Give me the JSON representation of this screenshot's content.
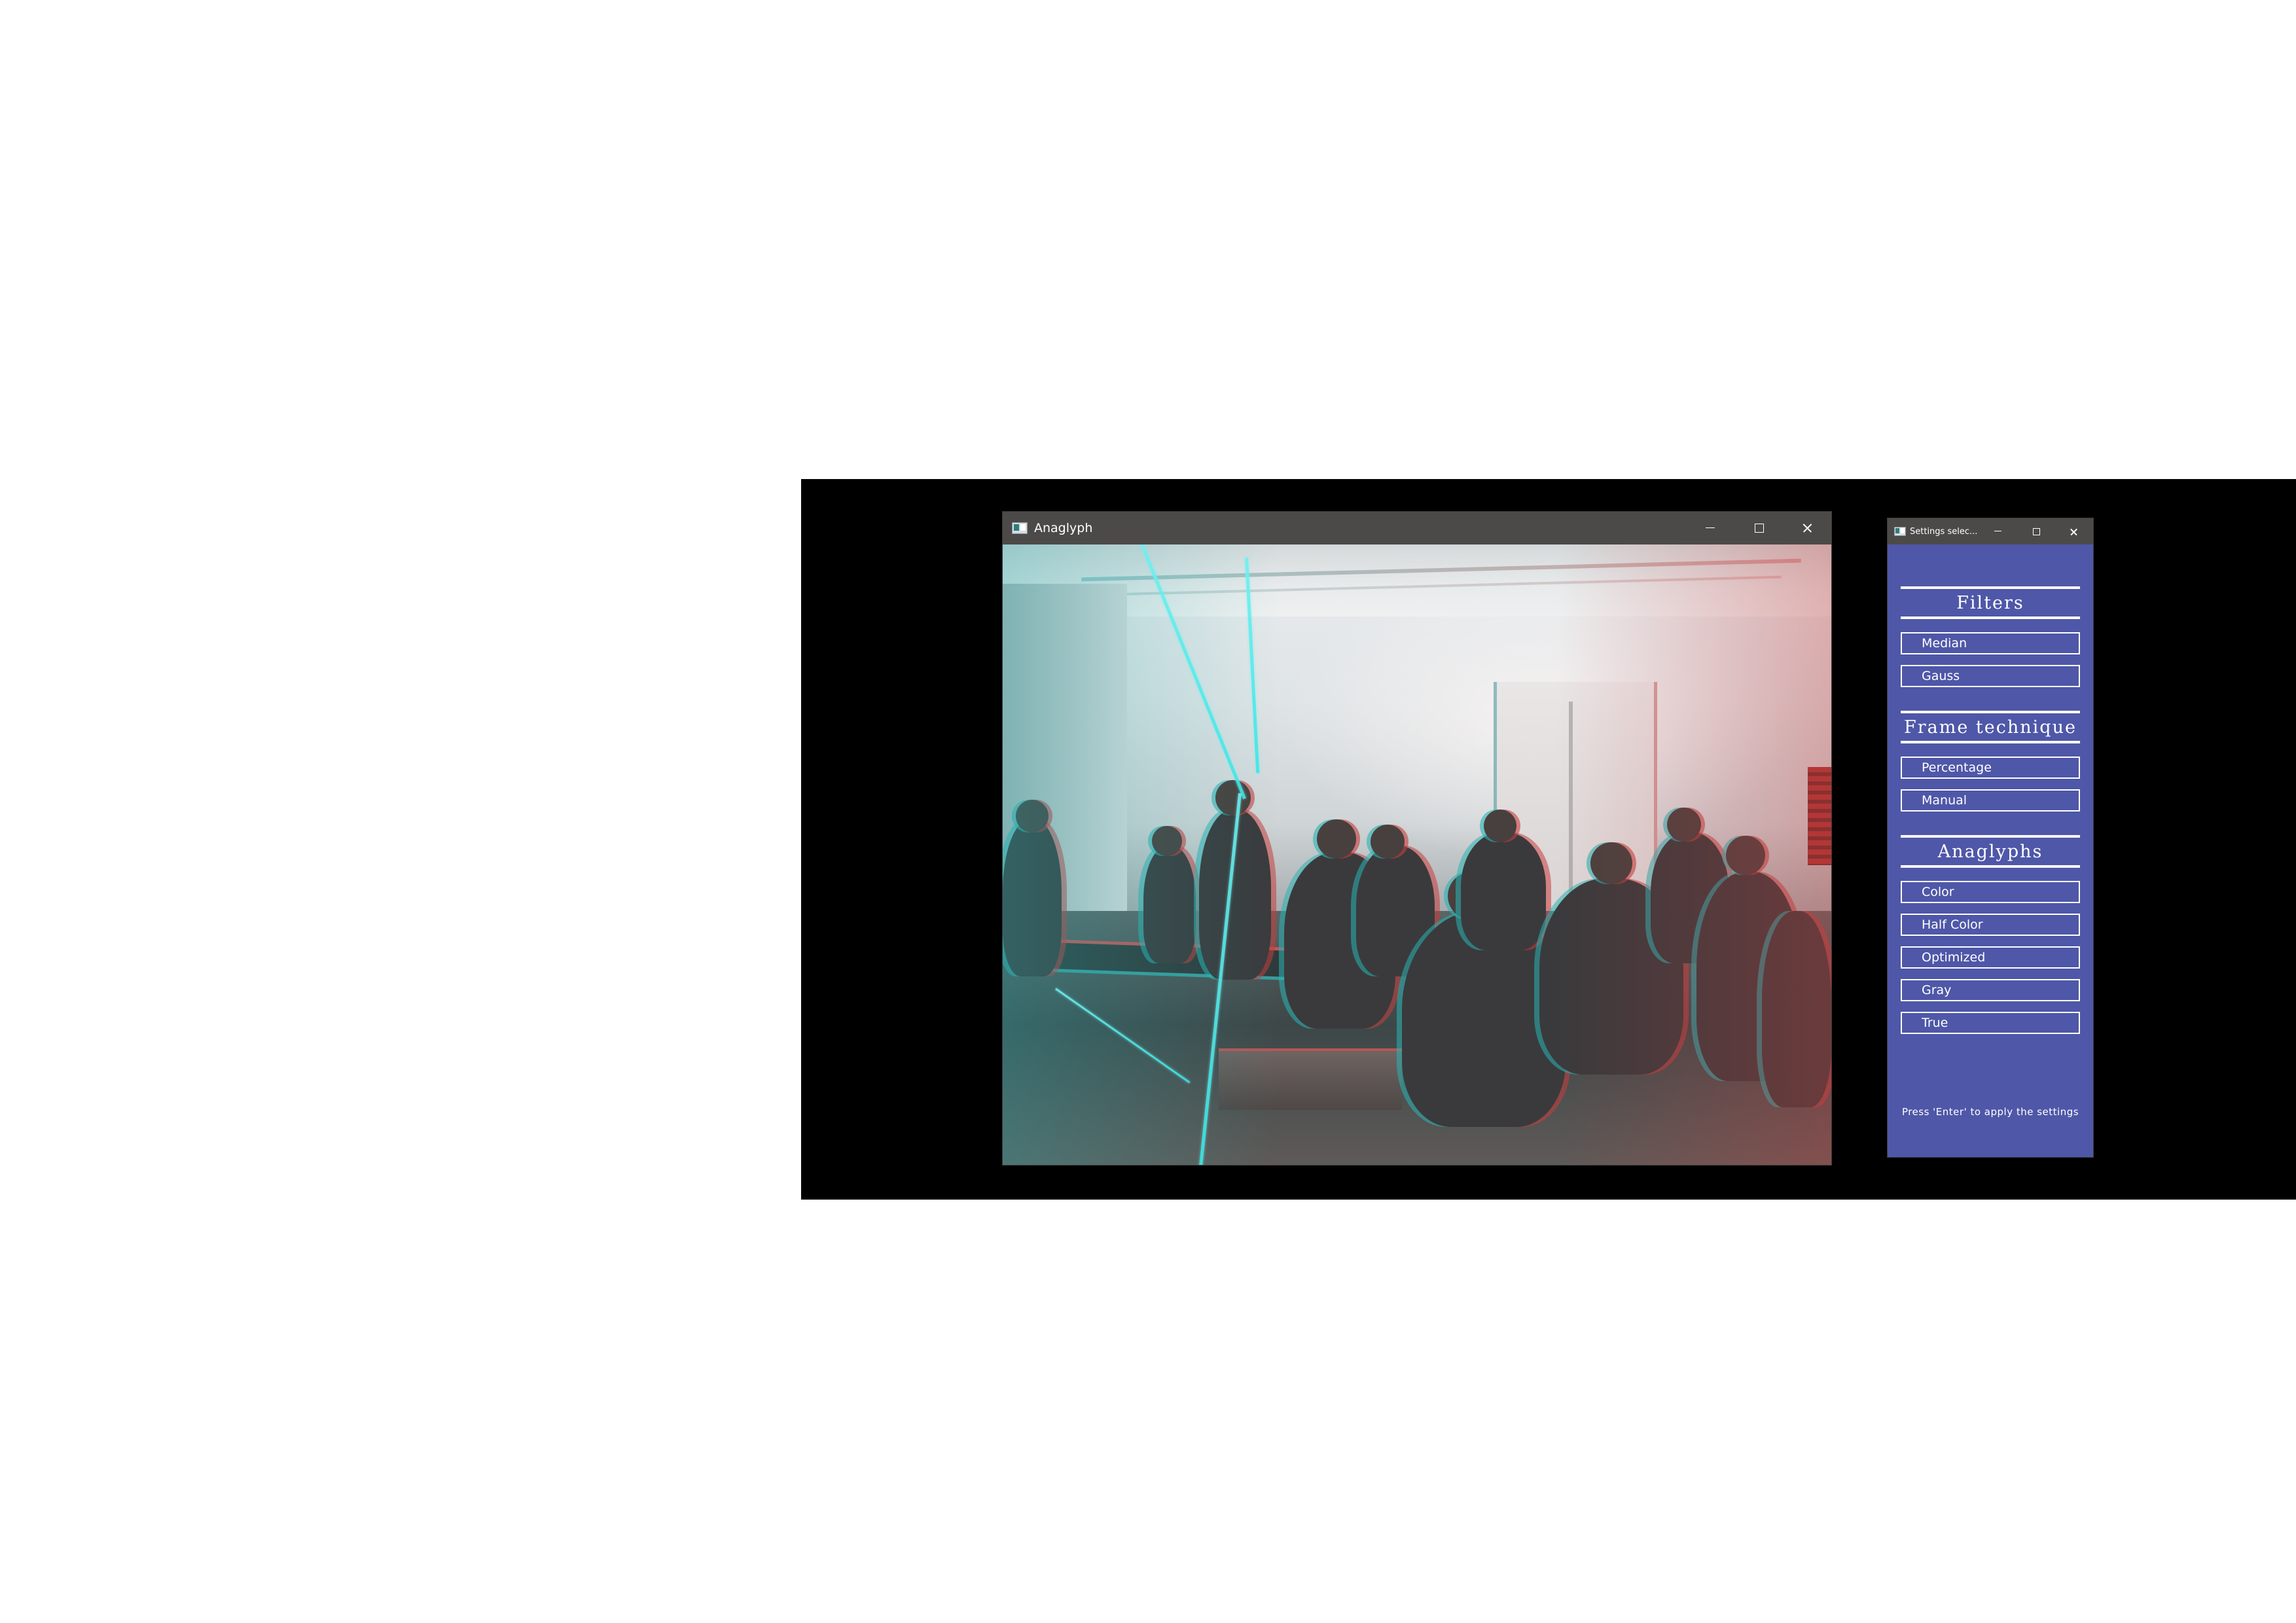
{
  "anaglyph_window": {
    "title": "Anaglyph",
    "controls": [
      "minimize",
      "maximize",
      "close"
    ]
  },
  "settings_window": {
    "title": "Settings selec...",
    "controls": [
      "minimize",
      "maximize",
      "close"
    ],
    "sections": [
      {
        "heading": "Filters",
        "options": [
          "Median",
          "Gauss"
        ]
      },
      {
        "heading": "Frame technique",
        "options": [
          "Percentage",
          "Manual"
        ]
      },
      {
        "heading": "Anaglyphs",
        "options": [
          "Color",
          "Half Color",
          "Optimized",
          "Gray",
          "True"
        ]
      }
    ],
    "hint": "Press 'Enter' to apply the settings"
  },
  "colors": {
    "desktop": "#000000",
    "titlebar": "#4c4a48",
    "settings_background": "#4f57a8",
    "foreground": "#ffffff"
  },
  "icons": {
    "app_icon": "app-icon",
    "minimize": "minimize-icon",
    "maximize": "maximize-icon",
    "close": "close-icon"
  }
}
